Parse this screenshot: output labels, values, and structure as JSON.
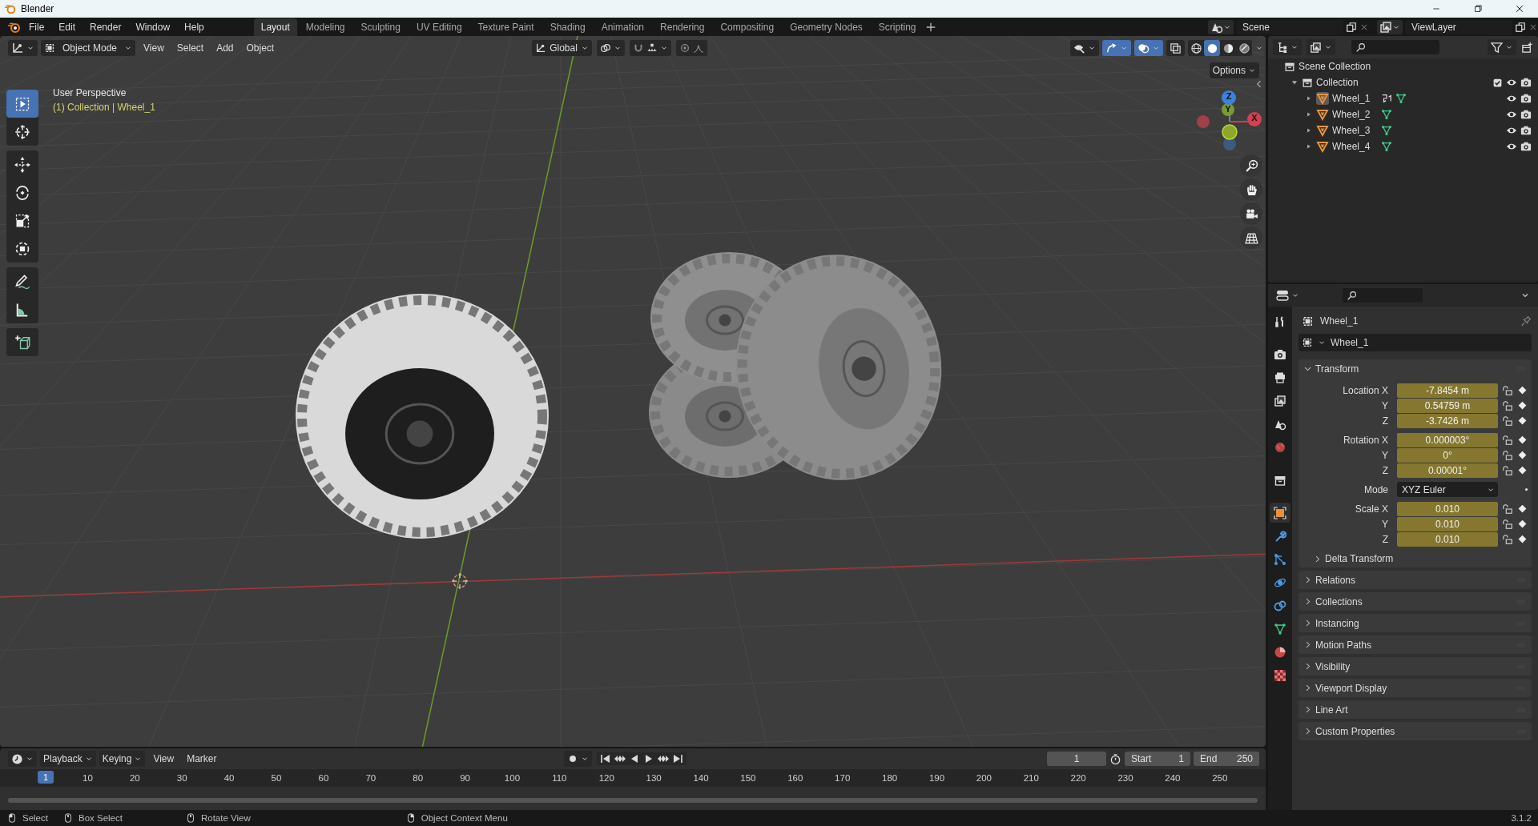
{
  "window": {
    "title": "Blender"
  },
  "menu": [
    "File",
    "Edit",
    "Render",
    "Window",
    "Help"
  ],
  "workspaces": [
    {
      "label": "Layout",
      "selected": true
    },
    {
      "label": "Modeling",
      "selected": false
    },
    {
      "label": "Sculpting",
      "selected": false
    },
    {
      "label": "UV Editing",
      "selected": false
    },
    {
      "label": "Texture Paint",
      "selected": false
    },
    {
      "label": "Shading",
      "selected": false
    },
    {
      "label": "Animation",
      "selected": false
    },
    {
      "label": "Rendering",
      "selected": false
    },
    {
      "label": "Compositing",
      "selected": false
    },
    {
      "label": "Geometry Nodes",
      "selected": false
    },
    {
      "label": "Scripting",
      "selected": false
    }
  ],
  "scene": {
    "name": "Scene"
  },
  "view_layer": {
    "name": "ViewLayer"
  },
  "viewport": {
    "mode": "Object Mode",
    "menus": [
      "View",
      "Select",
      "Add",
      "Object"
    ],
    "orientation": "Global",
    "options": "Options",
    "toggles": [
      {
        "kind": "visibility",
        "on": false
      },
      {
        "kind": "gizmos",
        "on": true
      },
      {
        "kind": "overlays",
        "on": true
      },
      {
        "kind": "xray",
        "on": false
      }
    ],
    "shading": [
      {
        "kind": "wireframe",
        "selected": false
      },
      {
        "kind": "solid",
        "selected": true
      },
      {
        "kind": "material",
        "selected": false
      },
      {
        "kind": "rendered",
        "selected": false
      }
    ],
    "snap": {
      "on": false
    },
    "proportional": {
      "on": false
    },
    "overlay_title": "User Perspective",
    "overlay_context": "(1) Collection | Wheel_1",
    "toolbar": [
      {
        "tools": [
          {
            "kind": "select",
            "selected": true
          },
          {
            "kind": "cursor",
            "selected": false
          }
        ]
      },
      {
        "tools": [
          {
            "kind": "move",
            "selected": false
          },
          {
            "kind": "rotate",
            "selected": false
          },
          {
            "kind": "scale",
            "selected": false
          },
          {
            "kind": "transform",
            "selected": false
          }
        ]
      },
      {
        "tools": [
          {
            "kind": "annotate",
            "selected": false
          },
          {
            "kind": "measure",
            "selected": false
          }
        ]
      },
      {
        "tools": [
          {
            "kind": "add_cube",
            "selected": false
          }
        ]
      }
    ],
    "gizmo": [
      "Z",
      "Y",
      "X"
    ]
  },
  "outliner": {
    "root": "Scene Collection",
    "collection": {
      "label": "Collection",
      "expanded": true,
      "checked": true,
      "children": [
        {
          "label": "Wheel_1",
          "selected": true,
          "expanded": false,
          "has_modifier": true
        },
        {
          "label": "Wheel_2",
          "selected": false,
          "expanded": false,
          "has_modifier": false
        },
        {
          "label": "Wheel_3",
          "selected": false,
          "expanded": false,
          "has_modifier": false
        },
        {
          "label": "Wheel_4",
          "selected": false,
          "expanded": false,
          "has_modifier": false
        }
      ]
    }
  },
  "properties": {
    "tabs": [
      {
        "kind": "tool",
        "selected": false
      },
      {
        "kind": "render",
        "selected": false
      },
      {
        "kind": "output",
        "selected": false
      },
      {
        "kind": "view_layer",
        "selected": false
      },
      {
        "kind": "scene",
        "selected": false
      },
      {
        "kind": "world",
        "selected": false
      },
      {
        "kind": "collection",
        "selected": false
      },
      {
        "kind": "object",
        "selected": true
      },
      {
        "kind": "modifiers",
        "selected": false
      },
      {
        "kind": "particles",
        "selected": false
      },
      {
        "kind": "physics",
        "selected": false
      },
      {
        "kind": "constraints",
        "selected": false
      },
      {
        "kind": "data",
        "selected": false
      },
      {
        "kind": "material",
        "selected": false
      },
      {
        "kind": "texture",
        "selected": false
      }
    ],
    "object_name": "Wheel_1",
    "datablock": "Wheel_1",
    "panels": [
      {
        "title": "Transform",
        "expanded": true,
        "groups": [
          {
            "rows": [
              {
                "kind": "field",
                "label": "Location X",
                "value": "-7.8454 m"
              },
              {
                "kind": "field",
                "label": "Y",
                "value": "0.54759 m"
              },
              {
                "kind": "field",
                "label": "Z",
                "value": "-3.7426 m"
              }
            ]
          },
          {
            "rows": [
              {
                "kind": "field",
                "label": "Rotation X",
                "value": "0.000003°"
              },
              {
                "kind": "field",
                "label": "Y",
                "value": "0°"
              },
              {
                "kind": "field",
                "label": "Z",
                "value": "0.00001°"
              }
            ]
          },
          {
            "rows": [
              {
                "kind": "dropdown",
                "label": "Mode",
                "value": "XYZ Euler"
              }
            ]
          },
          {
            "rows": [
              {
                "kind": "field",
                "label": "Scale X",
                "value": "0.010"
              },
              {
                "kind": "field",
                "label": "Y",
                "value": "0.010"
              },
              {
                "kind": "field",
                "label": "Z",
                "value": "0.010"
              }
            ]
          }
        ],
        "subpanels": [
          {
            "title": "Delta Transform",
            "expanded": false
          }
        ]
      },
      {
        "title": "Relations",
        "expanded": false
      },
      {
        "title": "Collections",
        "expanded": false
      },
      {
        "title": "Instancing",
        "expanded": false
      },
      {
        "title": "Motion Paths",
        "expanded": false
      },
      {
        "title": "Visibility",
        "expanded": false
      },
      {
        "title": "Viewport Display",
        "expanded": false
      },
      {
        "title": "Line Art",
        "expanded": false
      },
      {
        "title": "Custom Properties",
        "expanded": false
      }
    ]
  },
  "timeline": {
    "menus": [
      "Playback",
      "Keying",
      "View",
      "Marker"
    ],
    "frame": "1",
    "start_label": "Start",
    "start": "1",
    "end_label": "End",
    "end": "250",
    "current": "1",
    "ticks": [
      "10",
      "20",
      "30",
      "40",
      "50",
      "60",
      "70",
      "80",
      "90",
      "100",
      "110",
      "120",
      "130",
      "140",
      "150",
      "160",
      "170",
      "180",
      "190",
      "200",
      "210",
      "220",
      "230",
      "240",
      "250"
    ]
  },
  "status_bar": {
    "items": [
      {
        "kind": "left",
        "label": "Select"
      },
      {
        "kind": "middle",
        "label": "Box Select"
      },
      {
        "kind": "middle",
        "label": "Rotate View"
      },
      {
        "kind": "right",
        "label": "Object Context Menu"
      }
    ],
    "version": "3.1.2"
  }
}
